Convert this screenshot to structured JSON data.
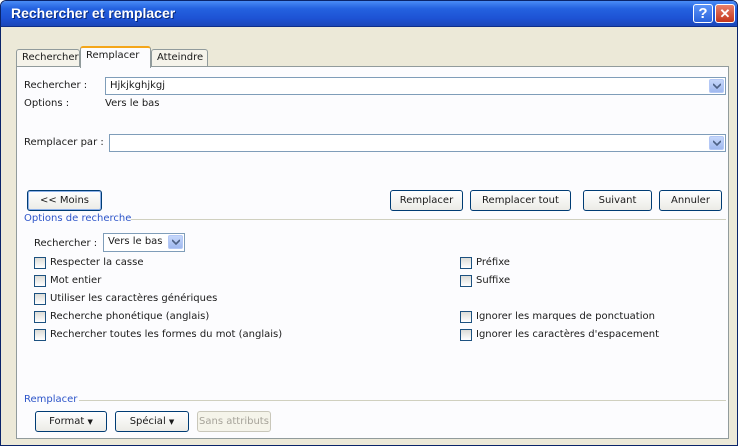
{
  "window": {
    "title": "Rechercher et remplacer"
  },
  "tabs": [
    {
      "label": "Rechercher",
      "mnemonic_index": 0
    },
    {
      "label": "Remplacer",
      "mnemonic_index": 3
    },
    {
      "label": "Atteindre",
      "mnemonic_index": 0
    }
  ],
  "search": {
    "label": "Rechercher :",
    "value": "Hjkjkghjkgj",
    "options_label": "Options :",
    "options_value": "Vers le bas"
  },
  "replace": {
    "label": "Remplacer par :",
    "value": ""
  },
  "buttons": {
    "less": "<< Moins",
    "replace": "Remplacer",
    "replace_all": "Remplacer tout",
    "next": "Suivant",
    "cancel": "Annuler"
  },
  "search_options": {
    "title": "Options de recherche",
    "direction_label": "Rechercher :",
    "direction_value": "Vers le bas",
    "left": [
      {
        "label": "Respecter la casse",
        "checked": false
      },
      {
        "label": "Mot entier",
        "checked": false
      },
      {
        "label": "Utiliser les caractères génériques",
        "checked": false
      },
      {
        "label": "Recherche phonétique (anglais)",
        "checked": false
      },
      {
        "label": "Rechercher toutes les formes du mot (anglais)",
        "checked": false
      }
    ],
    "right": [
      {
        "label": "Préfixe",
        "checked": false
      },
      {
        "label": "Suffixe",
        "checked": false
      },
      {
        "label": "Ignorer les marques de ponctuation",
        "checked": false
      },
      {
        "label": "Ignorer les caractères d'espacement",
        "checked": false
      }
    ]
  },
  "replace_group": {
    "title": "Remplacer",
    "format": "Format",
    "special": "Spécial",
    "no_attributes": "Sans attributs"
  },
  "colors": {
    "title_bar": "#1d52d4",
    "group_title": "#2d55c9",
    "tab_highlight": "#f4a61a"
  }
}
